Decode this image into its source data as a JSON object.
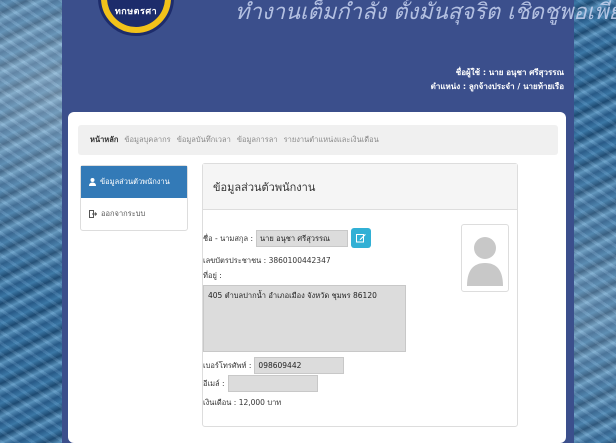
{
  "header": {
    "title": "ทำงานเต็มกำลัง ตั้งมั่นสุจริต เชิดชูพอเพียง",
    "logo_text": "ทกษตรศา",
    "user_label": "ชื่อผู้ใช้ : นาย อนุชา ศรีสุวรรณ",
    "position_label": "ตำแหน่ง : ลูกจ้างประจำ / นายท้ายเรือ"
  },
  "menu": {
    "items": [
      {
        "label": "หน้าหลัก"
      },
      {
        "label": "ข้อมูลบุคลากร"
      },
      {
        "label": "ข้อมูลบันทึกเวลา"
      },
      {
        "label": "ข้อมูลการลา"
      },
      {
        "label": "รายงานตำแหน่งและเงินเดือน"
      }
    ]
  },
  "sidebar": {
    "items": [
      {
        "label": "ข้อมูลส่วนตัวพนักงาน",
        "icon": "user-icon"
      },
      {
        "label": "ออกจากระบบ",
        "icon": "logout-icon"
      }
    ]
  },
  "card": {
    "title": "ข้อมูลส่วนตัวพนักงาน",
    "name_label": "ชื่อ - นามสกุล :",
    "name_value": "นาย อนุชา ศรีสุวรรณ",
    "id_label": "เลขบัตรประชาชน : 3860100442347",
    "address_label": "ที่อยู่ :",
    "address_value": "405 ตำบลปากน้ำ อำเภอเมือง จังหวัด ชุมพร 86120",
    "phone_label": "เบอร์โทรศัพท์ :",
    "phone_value": "098609442",
    "email_label": "อีเมล์ :",
    "email_value": "",
    "salary_label": "เงินเดือน : 12,000 บาท"
  },
  "colors": {
    "frame": "#3b4f8c",
    "sidebar_active": "#337ab7",
    "edit_button": "#31b0d5"
  }
}
